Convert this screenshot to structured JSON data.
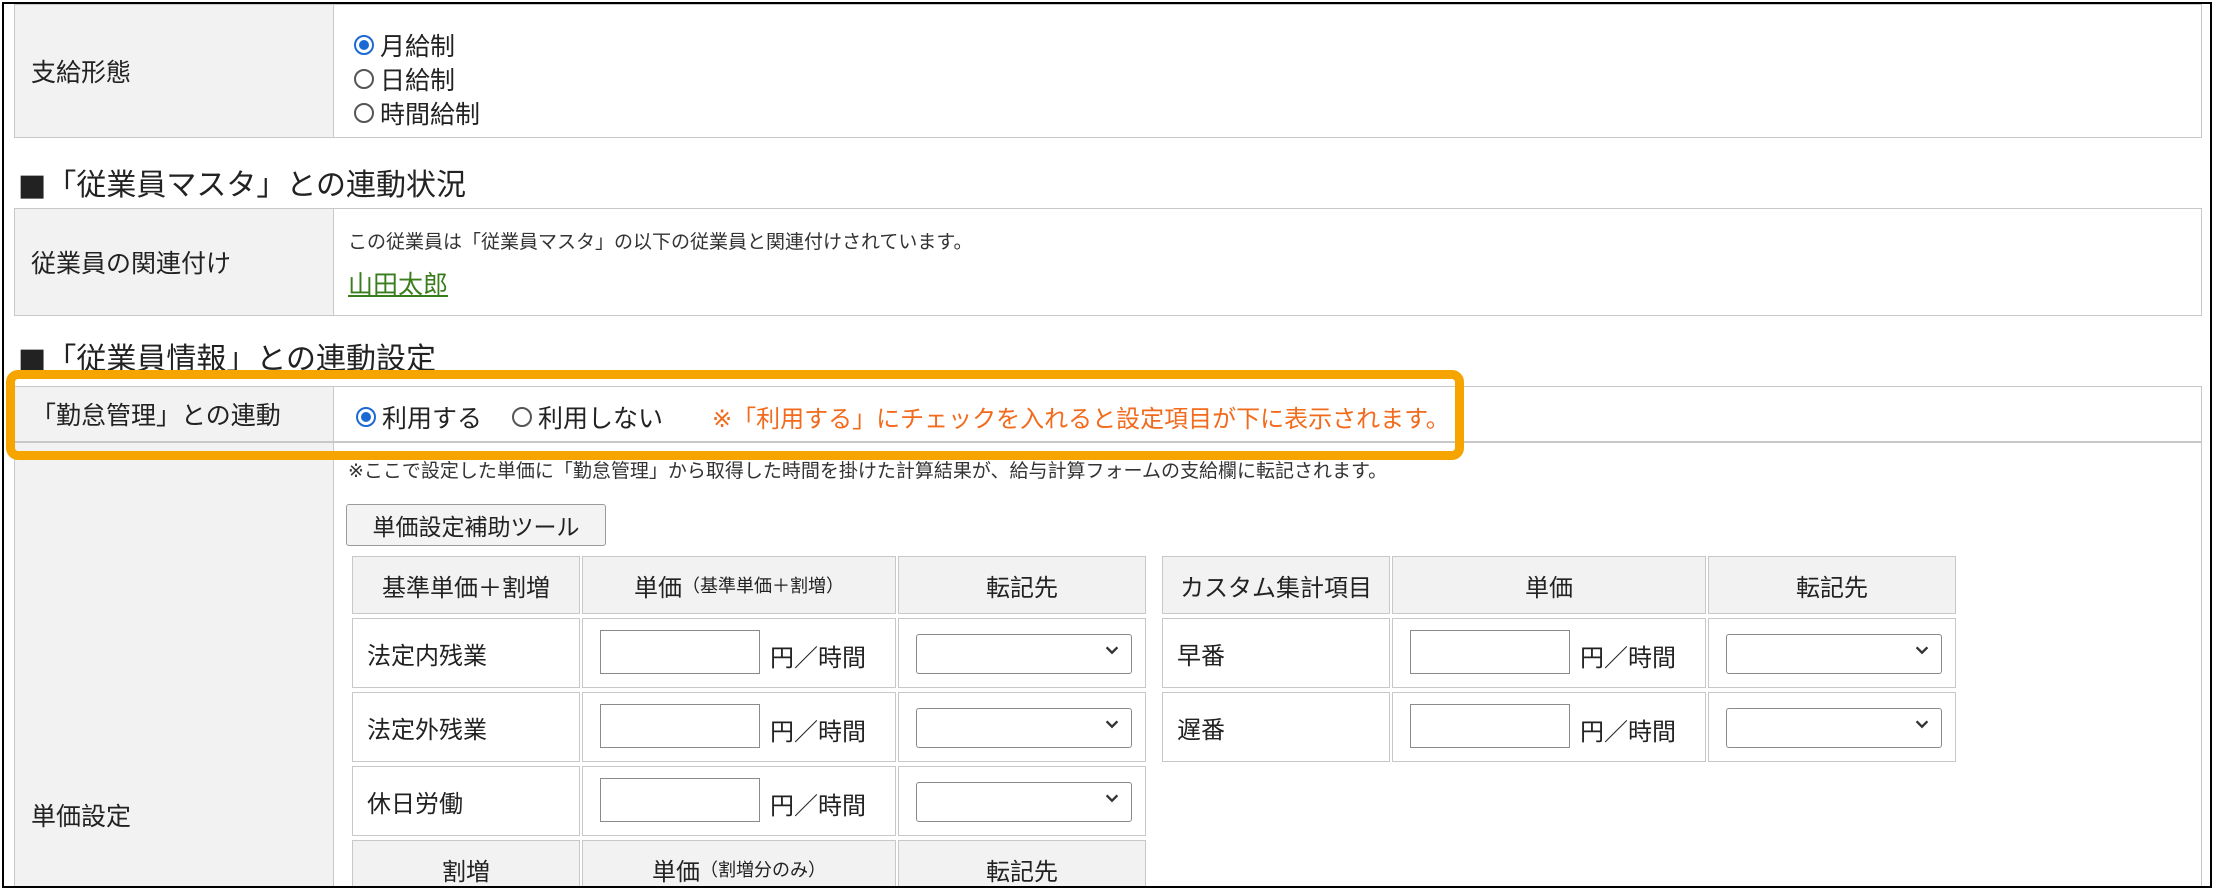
{
  "pay_type": {
    "label": "支給形態",
    "options": [
      {
        "label": "月給制",
        "checked": true
      },
      {
        "label": "日給制",
        "checked": false
      },
      {
        "label": "時間給制",
        "checked": false
      }
    ]
  },
  "sections": {
    "master_link_status": "■「従業員マスタ」との連動状況",
    "info_link_settings": "■「従業員情報」との連動設定"
  },
  "employee_association": {
    "label": "従業員の関連付け",
    "description": "この従業員は「従業員マスタ」の以下の従業員と関連付けされています。",
    "employee_link": "山田太郎"
  },
  "attendance_link": {
    "label": "「勤怠管理」との連動",
    "options": [
      {
        "label": "利用する",
        "checked": true
      },
      {
        "label": "利用しない",
        "checked": false
      }
    ],
    "note": "※「利用する」にチェックを入れると設定項目が下に表示されます。"
  },
  "unit_price": {
    "label": "単価設定",
    "note": "※ここで設定した単価に「勤怠管理」から取得した時間を掛けた計算結果が、給与計算フォームの支給欄に転記されます。",
    "helper_button": "単価設定補助ツール",
    "left_table": {
      "headers": {
        "item": "基準単価＋割増",
        "price_main": "単価",
        "price_sub": "（基準単価＋割増）",
        "destination": "転記先"
      },
      "rows": [
        {
          "label": "法定内残業",
          "value": "",
          "unit": "円／時間",
          "destination": ""
        },
        {
          "label": "法定外残業",
          "value": "",
          "unit": "円／時間",
          "destination": ""
        },
        {
          "label": "休日労働",
          "value": "",
          "unit": "円／時間",
          "destination": ""
        }
      ],
      "premium_headers": {
        "item": "割増",
        "price_main": "単価",
        "price_sub": "（割増分のみ）",
        "destination": "転記先"
      }
    },
    "right_table": {
      "headers": {
        "item": "カスタム集計項目",
        "price": "単価",
        "destination": "転記先"
      },
      "rows": [
        {
          "label": "早番",
          "value": "",
          "unit": "円／時間",
          "destination": ""
        },
        {
          "label": "遅番",
          "value": "",
          "unit": "円／時間",
          "destination": ""
        }
      ]
    }
  },
  "colors": {
    "highlight": "#f5a400",
    "note_orange": "#f26a1b",
    "link_green": "#3a7d1c",
    "radio_blue": "#1b6ad4",
    "label_bg": "#f2f2f2"
  }
}
